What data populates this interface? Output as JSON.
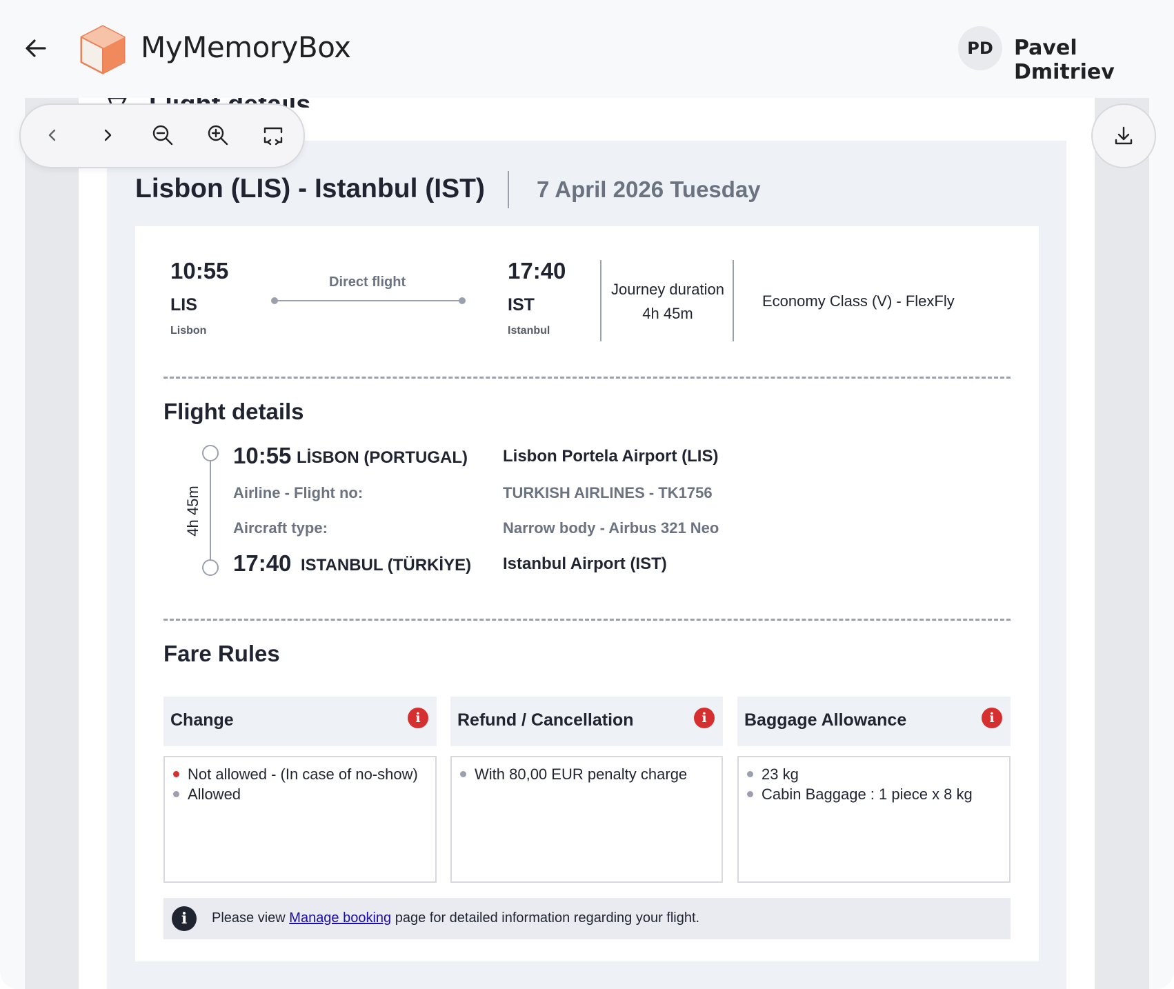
{
  "header": {
    "app_name": "MyMemoryBox",
    "user_initials": "PD",
    "user_name": "Pavel Dmitriev"
  },
  "document": {
    "cut_heading": "Flight details",
    "route": "Lisbon (LIS) - Istanbul (IST)",
    "date": "7 April 2026 Tuesday",
    "summary": {
      "departure_time": "10:55",
      "departure_code": "LIS",
      "departure_city": "Lisbon",
      "direct_label": "Direct flight",
      "arrival_time": "17:40",
      "arrival_code": "IST",
      "arrival_city": "Istanbul",
      "duration_label": "Journey duration",
      "duration": "4h 45m",
      "fare_class": "Economy Class (V) - FlexFly"
    },
    "flight_details": {
      "title": "Flight details",
      "duration": "4h 45m",
      "departure_time": "10:55",
      "departure_city": "LİSBON (PORTUGAL)",
      "departure_airport": "Lisbon Portela Airport (LIS)",
      "airline_label": "Airline - Flight no:",
      "airline_value": "TURKISH AIRLINES - TK1756",
      "aircraft_label": "Aircraft type:",
      "aircraft_value": "Narrow body - Airbus 321 Neo",
      "arrival_time": "17:40",
      "arrival_city": "ISTANBUL (TÜRKİYE)",
      "arrival_airport": "Istanbul Airport (IST)"
    },
    "fare_rules": {
      "title": "Fare Rules",
      "change": {
        "title": "Change",
        "items": [
          "Not allowed - (In case of no-show)",
          "Allowed"
        ]
      },
      "refund": {
        "title": "Refund / Cancellation",
        "items": [
          "With 80,00 EUR penalty charge"
        ]
      },
      "baggage": {
        "title": "Baggage Allowance",
        "items": [
          "23 kg",
          "Cabin Baggage : 1 piece x 8 kg"
        ]
      }
    },
    "note": {
      "prefix": "Please view ",
      "link": "Manage booking",
      "suffix": " page for detailed information regarding your flight."
    }
  },
  "icons": {
    "info": "i",
    "back": "arrow-left-icon",
    "prev": "chevron-left-icon",
    "next": "chevron-right-icon",
    "zoom_out": "zoom-out-icon",
    "zoom_in": "zoom-in-icon",
    "fit": "fit-width-icon",
    "download": "download-icon"
  },
  "colors": {
    "accent_orange": "#f08a5d",
    "info_red": "#d62f2f",
    "bullet_red": "#d62f2f",
    "bullet_gray": "#9aa1ad",
    "muted_text": "#6b7280"
  }
}
